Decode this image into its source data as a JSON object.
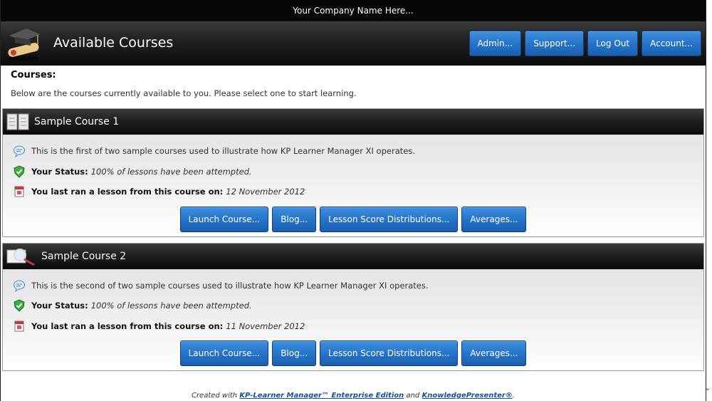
{
  "company": "Your Company Name Here...",
  "header": {
    "title": "Available Courses",
    "nav": [
      "Admin...",
      "Support...",
      "Log Out",
      "Account..."
    ]
  },
  "intro": {
    "heading": "Courses:",
    "text": "Below are the courses currently available to you. Please select one to start learning."
  },
  "courses": [
    {
      "title": "Sample Course 1",
      "description": "This is the first of two sample courses used to illustrate how KP Learner Manager XI operates.",
      "status_label": "Your Status:",
      "status_value": "100% of lessons have been attempted.",
      "lastrun_label": "You last ran a lesson from this course on:",
      "lastrun_value": "12 November 2012",
      "buttons": [
        "Launch Course...",
        "Blog...",
        "Lesson Score Distributions...",
        "Averages..."
      ]
    },
    {
      "title": "Sample Course 2",
      "description": "This is the second of two sample courses used to illustrate how KP Learner Manager XI operates.",
      "status_label": "Your Status:",
      "status_value": "100% of lessons have been attempted.",
      "lastrun_label": "You last ran a lesson from this course on:",
      "lastrun_value": "11 November 2012",
      "buttons": [
        "Launch Course...",
        "Blog...",
        "Lesson Score Distributions...",
        "Averages..."
      ]
    }
  ],
  "footer": {
    "prefix": "Created with",
    "link1": "KP-Learner Manager™ Enterprise Edition",
    "middle": "and",
    "link2": "KnowledgePresenter®",
    "suffix": "."
  }
}
